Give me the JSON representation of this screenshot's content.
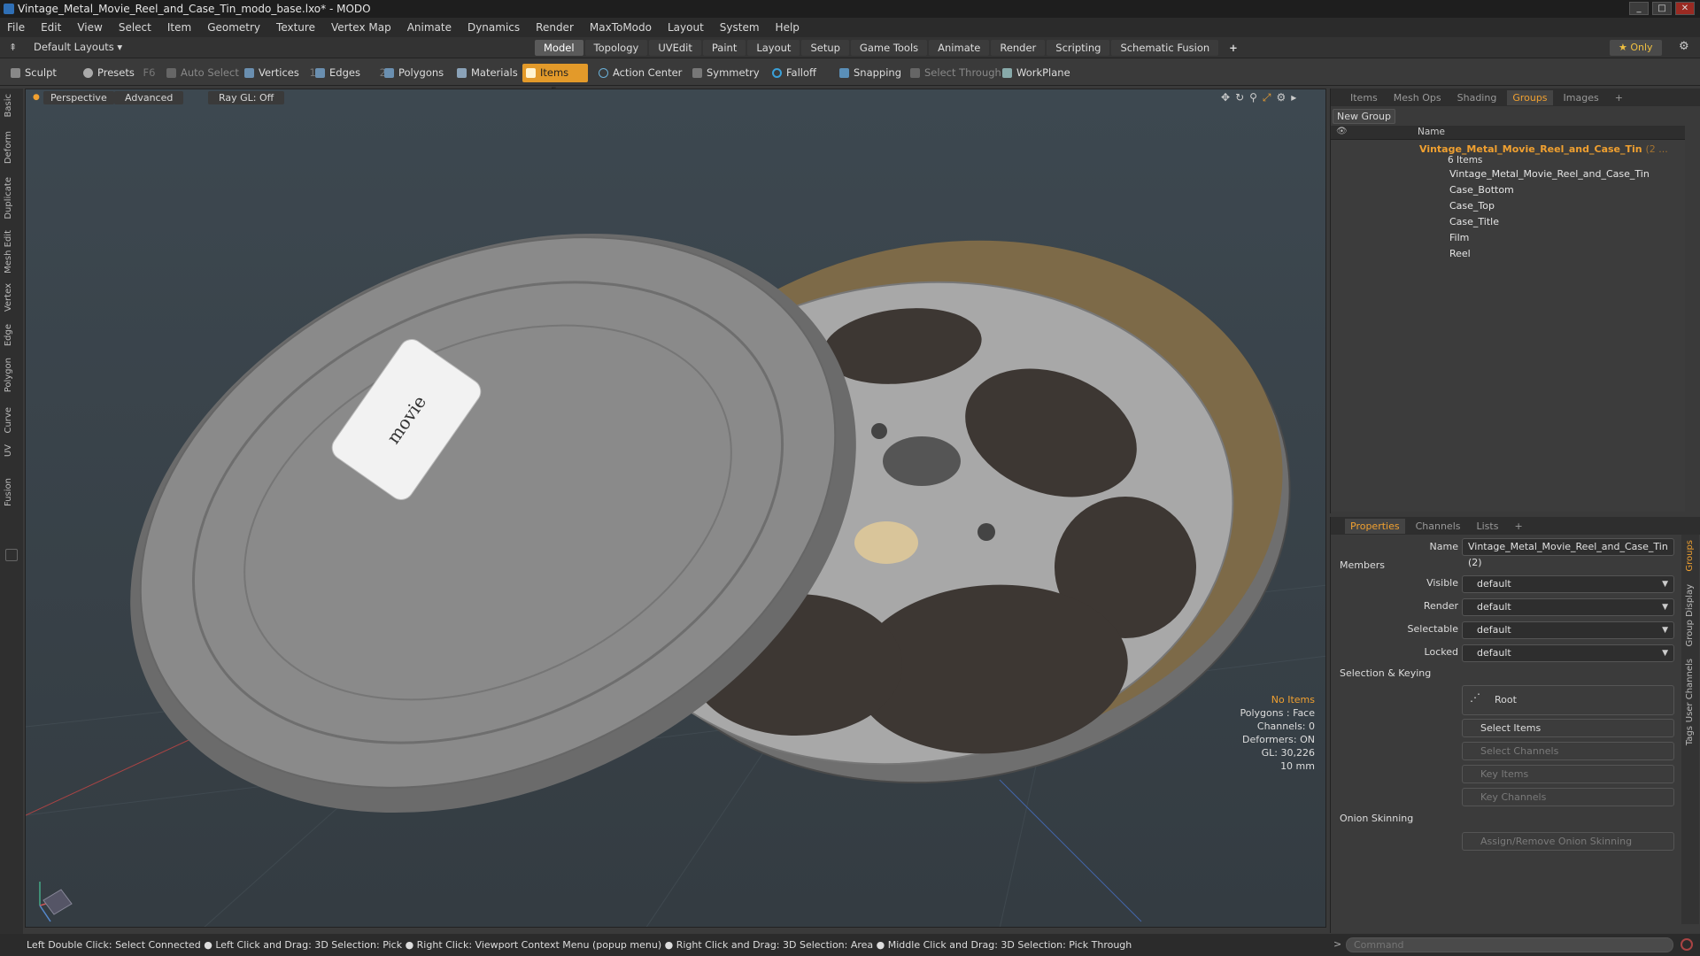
{
  "window": {
    "title": "Vintage_Metal_Movie_Reel_and_Case_Tin_modo_base.lxo* - MODO",
    "controls": [
      "_",
      "□",
      "✕"
    ]
  },
  "menu": [
    "File",
    "Edit",
    "View",
    "Select",
    "Item",
    "Geometry",
    "Texture",
    "Vertex Map",
    "Animate",
    "Dynamics",
    "Render",
    "MaxToModo",
    "Layout",
    "System",
    "Help"
  ],
  "layout_bar": {
    "layout_menu": "Default Layouts ▾",
    "tabs": [
      "Model",
      "Topology",
      "UVEdit",
      "Paint",
      "Layout",
      "Setup",
      "Game Tools",
      "Animate",
      "Render",
      "Scripting",
      "Schematic Fusion",
      "+"
    ],
    "active_tab": "Model",
    "only_label": "★  Only"
  },
  "toolbar": {
    "sculpt": "Sculpt",
    "presets": "Presets",
    "presets_key": "F6",
    "auto_select": "Auto Select",
    "vertices": "Vertices",
    "vertices_count": "1",
    "edges": "Edges",
    "edges_count": "2",
    "polygons": "Polygons",
    "materials": "Materials",
    "items": "Items",
    "items_count": "5",
    "action_center": "Action Center",
    "symmetry": "Symmetry",
    "falloff": "Falloff",
    "snapping": "Snapping",
    "select_through": "Select Through",
    "workplane": "WorkPlane"
  },
  "left_tabs": [
    "Basic",
    "Deform",
    "Duplicate",
    "Mesh Edit",
    "Vertex",
    "Edge",
    "Polygon",
    "Curve",
    "UV",
    "Fusion"
  ],
  "viewport": {
    "view_mode": "Perspective",
    "shading": "Advanced",
    "raygl": "Ray GL: Off",
    "label_text": "movie",
    "stats": {
      "no_items": "No Items",
      "polygons": "Polygons : Face",
      "channels": "Channels: 0",
      "deformers": "Deformers: ON",
      "gl": "GL: 30,226",
      "scale": "10 mm"
    }
  },
  "groups_panel": {
    "tabs": [
      "Items",
      "Mesh Ops",
      "Shading",
      "Groups",
      "Images",
      "+"
    ],
    "active_tab": "Groups",
    "new_group": "New Group",
    "name_header": "Name",
    "group_name": "Vintage_Metal_Movie_Reel_and_Case_Tin",
    "group_suffix": "(2 ...",
    "group_count": "6 Items",
    "children": [
      "Vintage_Metal_Movie_Reel_and_Case_Tin",
      "Case_Bottom",
      "Case_Top",
      "Case_Title",
      "Film",
      "Reel"
    ]
  },
  "properties_panel": {
    "tabs": [
      "Properties",
      "Channels",
      "Lists",
      "+"
    ],
    "active_tab": "Properties",
    "name_label": "Name",
    "name_value": "Vintage_Metal_Movie_Reel_and_Case_Tin (2)",
    "members_section": "Members",
    "visible_label": "Visible",
    "visible_value": "default",
    "render_label": "Render",
    "render_value": "default",
    "selectable_label": "Selectable",
    "selectable_value": "default",
    "locked_label": "Locked",
    "locked_value": "default",
    "selection_section": "Selection & Keying",
    "root_button": "Root",
    "select_items": "Select Items",
    "select_channels": "Select Channels",
    "key_items": "Key Items",
    "key_channels": "Key Channels",
    "onion_section": "Onion Skinning",
    "onion_button": "Assign/Remove Onion Skinning",
    "side_tabs": [
      "Groups",
      "Group Display",
      "User Channels",
      "Tags"
    ]
  },
  "status_bar": "Left Double Click: Select Connected ● Left Click and Drag: 3D Selection: Pick ● Right Click: Viewport Context Menu (popup menu) ● Right Click and Drag: 3D Selection: Area ● Middle Click and Drag: 3D Selection: Pick Through",
  "command": {
    "placeholder": "Command"
  },
  "colors": {
    "accent": "#f0a030",
    "viewport_bg": "#3a454c",
    "active_item": "#e09a2a"
  }
}
